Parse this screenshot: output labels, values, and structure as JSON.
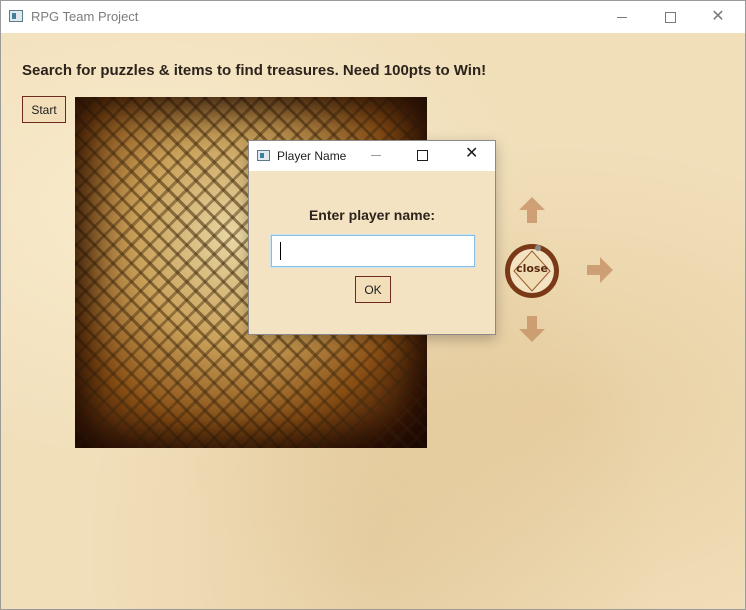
{
  "window": {
    "title": "RPG Team Project",
    "app_icon": "app-window-icon",
    "controls": {
      "minimize_icon": "minimize-icon",
      "maximize_icon": "maximize-icon",
      "close_icon": "close-icon"
    }
  },
  "main": {
    "instructions": "Search for puzzles & items to find treasures. Need 100pts to Win!",
    "start_label": "Start",
    "maze_image": "maze-map-image",
    "nav": {
      "up_icon": "arrow-up-icon",
      "down_icon": "arrow-down-icon",
      "right_icon": "arrow-right-icon",
      "close_label": "close"
    }
  },
  "dialog": {
    "title": "Player Name",
    "prompt": "Enter player name:",
    "input_value": "",
    "ok_label": "OK"
  },
  "colors": {
    "parchment": "#f1dfba",
    "button_border": "#6e2a1f",
    "arrow": "#c9956a",
    "input_focus": "#87bde0"
  }
}
